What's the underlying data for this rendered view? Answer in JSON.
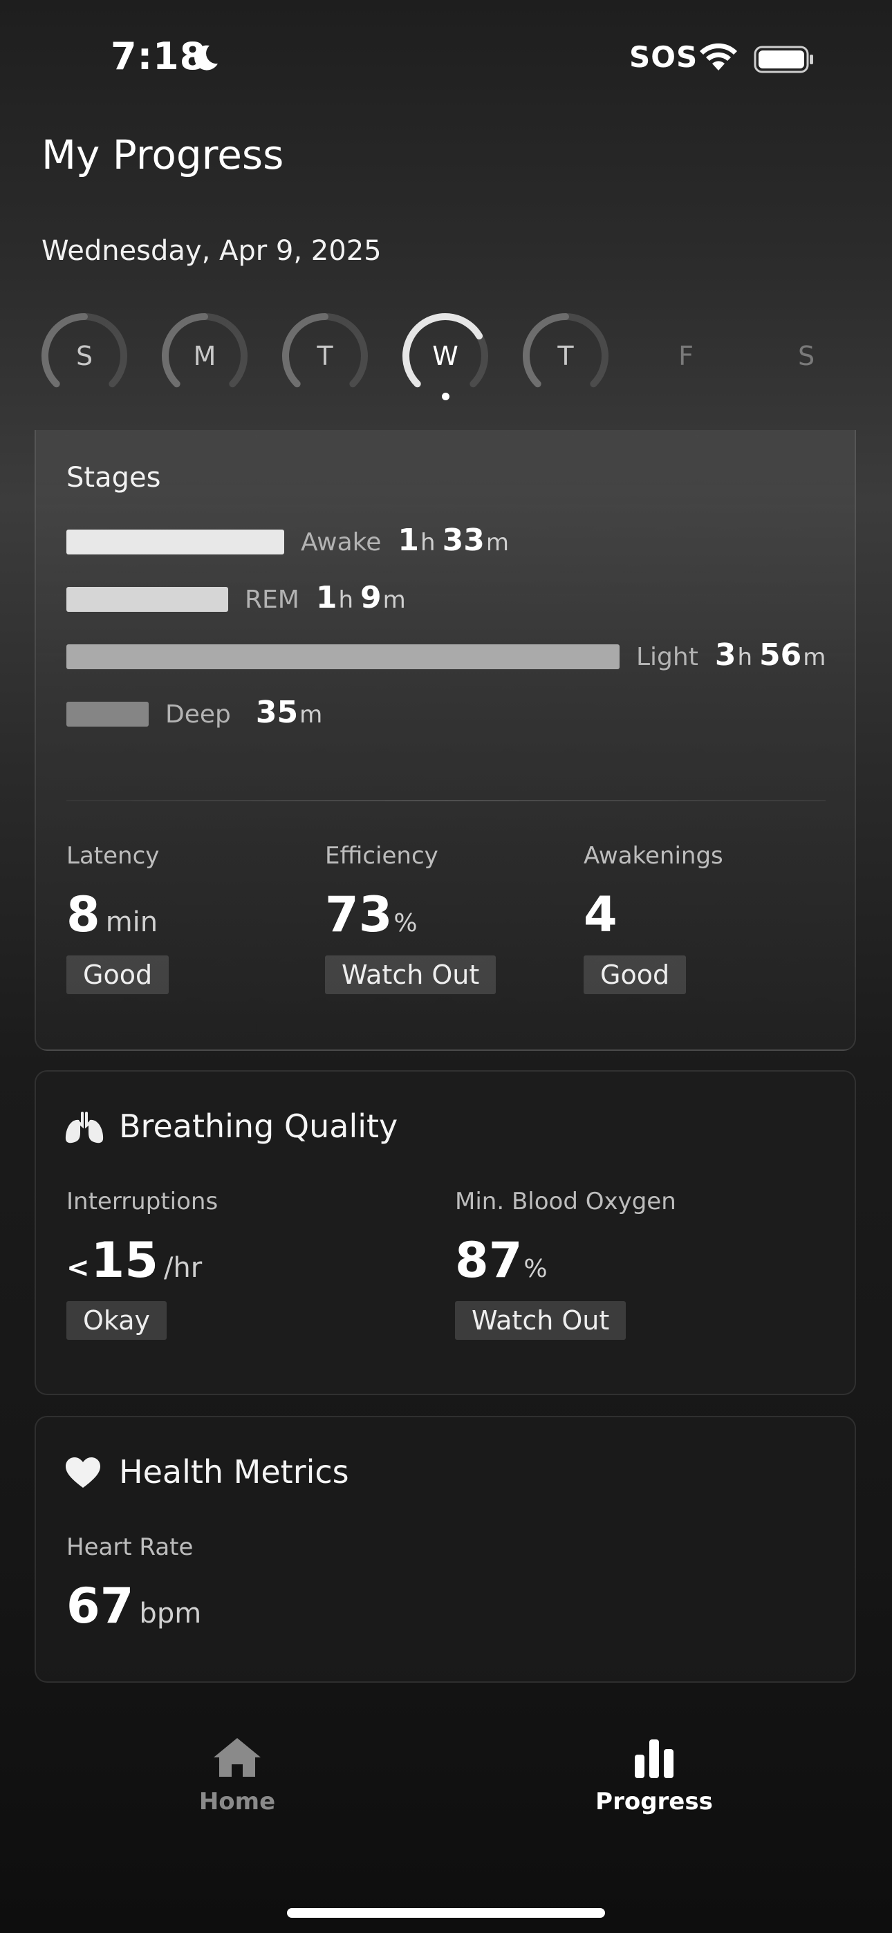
{
  "status_bar": {
    "time": "7:18",
    "sos": "SOS"
  },
  "header": {
    "title": "My Progress",
    "date": "Wednesday, Apr 9, 2025"
  },
  "week": {
    "days": [
      {
        "label": "S",
        "state": "has-data",
        "ring_fraction": 0.5
      },
      {
        "label": "M",
        "state": "has-data",
        "ring_fraction": 0.5
      },
      {
        "label": "T",
        "state": "has-data",
        "ring_fraction": 0.5
      },
      {
        "label": "W",
        "state": "selected",
        "ring_fraction": 0.72
      },
      {
        "label": "T",
        "state": "has-data",
        "ring_fraction": 0.5
      },
      {
        "label": "F",
        "state": "no-data",
        "ring_fraction": 0
      },
      {
        "label": "S",
        "state": "no-data",
        "ring_fraction": 0
      }
    ]
  },
  "stages": {
    "title": "Stages",
    "items": [
      {
        "name": "Awake",
        "hours": "1",
        "hours_unit": "h",
        "minutes": "33",
        "minutes_unit": "m",
        "total_minutes": 93,
        "color": "#e8e8e8"
      },
      {
        "name": "REM",
        "hours": "1",
        "hours_unit": "h",
        "minutes": "9",
        "minutes_unit": "m",
        "total_minutes": 69,
        "color": "#d6d6d6"
      },
      {
        "name": "Light",
        "hours": "3",
        "hours_unit": "h",
        "minutes": "56",
        "minutes_unit": "m",
        "total_minutes": 236,
        "color": "#aaaaaa"
      },
      {
        "name": "Deep",
        "hours": "",
        "hours_unit": "",
        "minutes": "35",
        "minutes_unit": "m",
        "total_minutes": 35,
        "color": "#858585"
      }
    ],
    "metrics": {
      "latency": {
        "label": "Latency",
        "value": "8",
        "unit": "min",
        "status": "Good"
      },
      "efficiency": {
        "label": "Efficiency",
        "value": "73",
        "unit": "%",
        "status": "Watch Out"
      },
      "awakenings": {
        "label": "Awakenings",
        "value": "4",
        "status": "Good"
      }
    }
  },
  "breathing": {
    "title": "Breathing Quality",
    "icon": "lungs-icon",
    "interruptions": {
      "label": "Interruptions",
      "prefix": "<",
      "value": "15",
      "unit": "/hr",
      "status": "Okay"
    },
    "blood_oxygen": {
      "label": "Min. Blood Oxygen",
      "value": "87",
      "unit": "%",
      "status": "Watch Out"
    }
  },
  "health": {
    "title": "Health Metrics",
    "icon": "heart-icon",
    "heart_rate": {
      "label": "Heart Rate",
      "value": "67",
      "unit": "bpm"
    }
  },
  "tab_bar": {
    "tabs": [
      {
        "label": "Home",
        "icon": "home-icon",
        "active": false,
        "color": "#8a8a8a"
      },
      {
        "label": "Progress",
        "icon": "bar-chart-icon",
        "active": true,
        "color": "#ffffff"
      }
    ]
  }
}
